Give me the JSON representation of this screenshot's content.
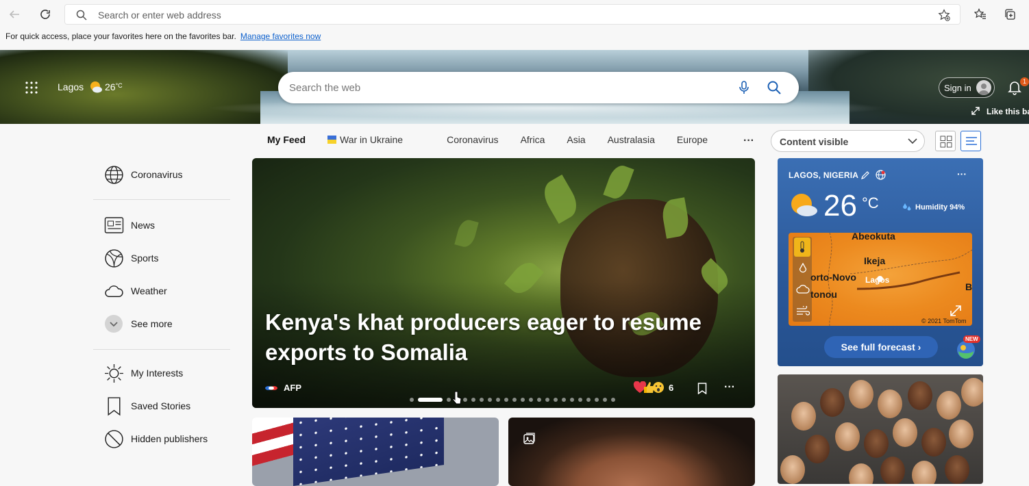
{
  "browser": {
    "address_placeholder": "Search or enter web address",
    "favbar_text": "For quick access, place your favorites here on the favorites bar.",
    "favbar_link": "Manage favorites now"
  },
  "header": {
    "city": "Lagos",
    "temp": "26",
    "temp_unit": "°C",
    "search_placeholder": "Search the web",
    "signin": "Sign in",
    "notif_count": "1",
    "like_bg": "Like this bac"
  },
  "tabs": {
    "items": [
      "My Feed",
      "War in Ukraine",
      "Coronavirus",
      "Africa",
      "Asia",
      "Australasia",
      "Europe"
    ],
    "more": "···"
  },
  "content_visibility": {
    "selected": "Content visible"
  },
  "sidebar": {
    "top": "Coronavirus",
    "section1": [
      "News",
      "Sports",
      "Weather",
      "See more"
    ],
    "section2": [
      "My Interests",
      "Saved Stories",
      "Hidden publishers"
    ]
  },
  "hero_card": {
    "headline": "Kenya's khat producers eager to resume exports to Somalia",
    "source": "AFP",
    "reaction_count": "6",
    "more": "···"
  },
  "weather_card": {
    "location": "LAGOS, NIGERIA",
    "temp": "26",
    "unit": "°C",
    "humidity": "Humidity 94%",
    "map_labels": [
      "Abeokuta",
      "Ikeja",
      "orto-Novo",
      "Lagos",
      "tonou",
      "B"
    ],
    "credit": "© 2021 TomTom",
    "forecast": "See full forecast ›",
    "new_badge": "NEW",
    "more": "···"
  },
  "colors": {
    "accent": "#0b5fcc",
    "weather_bg": "#2a5798"
  }
}
